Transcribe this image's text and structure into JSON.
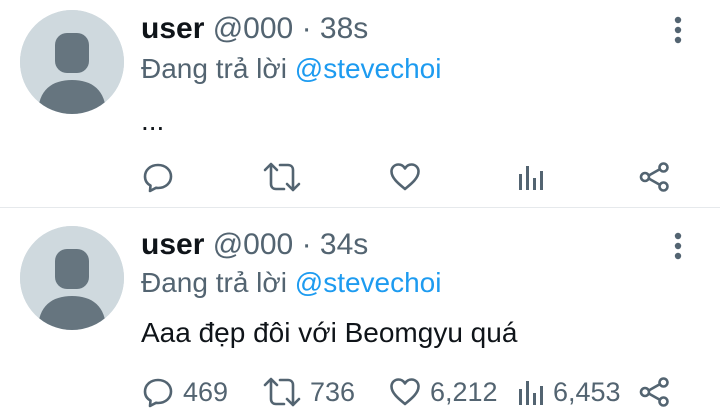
{
  "tweets": [
    {
      "name": "user",
      "handle": "@000",
      "dot": "·",
      "time": "38s",
      "reply_prefix": "Đang trả lời",
      "reply_to": "@stevechoi",
      "text": "...",
      "actions": {
        "reply_count": "",
        "retweet_count": "",
        "like_count": "",
        "views_count": ""
      }
    },
    {
      "name": "user",
      "handle": "@000",
      "dot": "·",
      "time": "34s",
      "reply_prefix": "Đang trả lời",
      "reply_to": "@stevechoi",
      "text": "Aaa đẹp đôi với Beomgyu quá",
      "actions": {
        "reply_count": "469",
        "retweet_count": "736",
        "like_count": "6,212",
        "views_count": "6,453"
      }
    }
  ],
  "icons": {
    "reply": "comment-bubble-icon",
    "retweet": "retweet-arrows-icon",
    "like": "heart-icon",
    "views": "bar-chart-icon",
    "share": "share-icon",
    "more": "vertical-dots-icon"
  },
  "colors": {
    "text": "#0f1419",
    "muted": "#536471",
    "mention": "#1d9bf0",
    "avatar_bg": "#cfd9de",
    "avatar_fg": "#66757f"
  }
}
